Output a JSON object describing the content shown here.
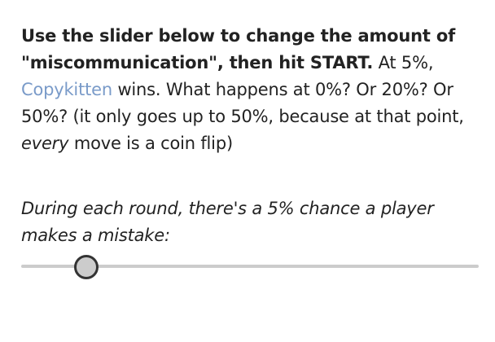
{
  "intro": {
    "bold_text": "Use the slider below to change the amount of \"miscommunication\", then hit START.",
    "text_after_bold": " At 5%, ",
    "link_text": "Copykitten",
    "text_after_link": " wins. What happens at 0%? Or 20%? Or 50%? (it only goes up to 50%, because at that point, ",
    "emphasis": "every",
    "text_end": " move is a coin flip)"
  },
  "caption": "During each round, there's a 5% chance a player makes a mistake:",
  "slider": {
    "value": 5,
    "min": 0,
    "max": 50,
    "unit": "%"
  },
  "colors": {
    "link": "#7a9bc9",
    "track": "#cccccc",
    "thumb_border": "#333333"
  }
}
